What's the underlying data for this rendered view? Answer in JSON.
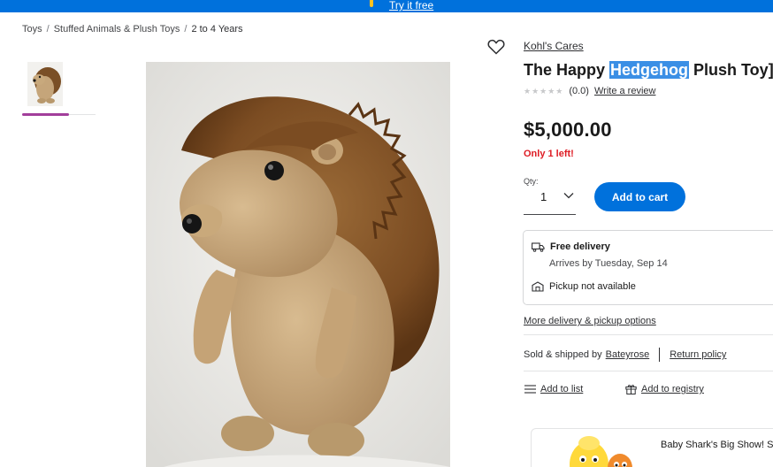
{
  "banner": {
    "link_text": "Try it free"
  },
  "breadcrumb": {
    "items": [
      "Toys",
      "Stuffed Animals & Plush Toys",
      "2 to 4 Years"
    ],
    "separator": "/"
  },
  "product": {
    "brand": "Kohl's Cares",
    "title_before": "The Happy ",
    "title_highlight": "Hedgehog",
    "title_after": " Plush Toy]",
    "rating_count": "(0.0)",
    "write_review": "Write a review",
    "price": "$5,000.00",
    "stock_status": "Only 1 left!"
  },
  "quantity": {
    "label": "Qty:",
    "value": "1"
  },
  "actions": {
    "add_to_cart": "Add to cart",
    "add_to_list": "Add to list",
    "add_to_registry": "Add to registry"
  },
  "delivery": {
    "title": "Free delivery",
    "arrives": "Arrives by Tuesday, Sep 14",
    "pickup": "Pickup not available",
    "more_options": "More delivery & pickup options"
  },
  "seller": {
    "prefix": "Sold & shipped by",
    "name": "Bateyrose",
    "return_policy": "Return policy"
  },
  "promo": {
    "text": "Baby Shark's Big Show! Si"
  },
  "colors": {
    "brand_blue": "#0071dc",
    "spark_yellow": "#ffc220",
    "alert_red": "#de1c24",
    "thumb_accent": "#a23e9b",
    "selection_highlight": "#3b8fe5"
  }
}
